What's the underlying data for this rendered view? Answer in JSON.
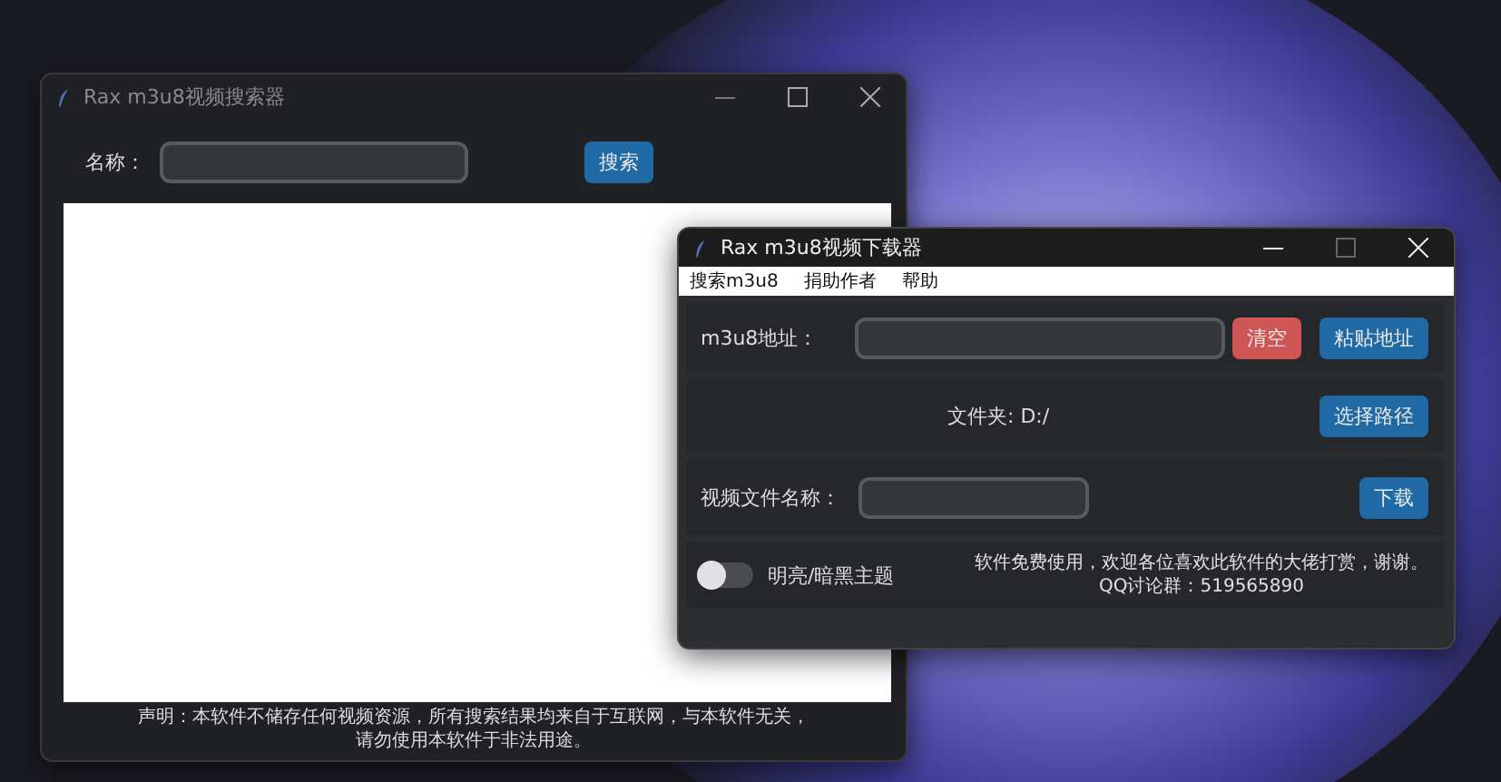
{
  "search_window": {
    "title": "Rax m3u8视频搜索器",
    "name_label": "名称：",
    "search_button": "搜索",
    "disclaimer": [
      "声明：本软件不储存任何视频资源，所有搜索结果均来自于互联网，与本软件无关，",
      "请勿使用本软件于非法用途。"
    ]
  },
  "download_window": {
    "title": "Rax m3u8视频下载器",
    "menu": [
      "搜索m3u8",
      "捐助作者",
      "帮助"
    ],
    "url_label": "m3u8地址：",
    "clear_button": "清空",
    "paste_button": "粘贴地址",
    "folder_label": "文件夹: D:/",
    "choose_path_button": "选择路径",
    "filename_label": "视频文件名称：",
    "download_button": "下载",
    "theme_toggle": {
      "label": "明亮/暗黑主题",
      "on": false
    },
    "notice": [
      "软件免费使用，欢迎各位喜欢此软件的大佬打赏，谢谢。",
      "QQ讨论群：519565890"
    ]
  }
}
